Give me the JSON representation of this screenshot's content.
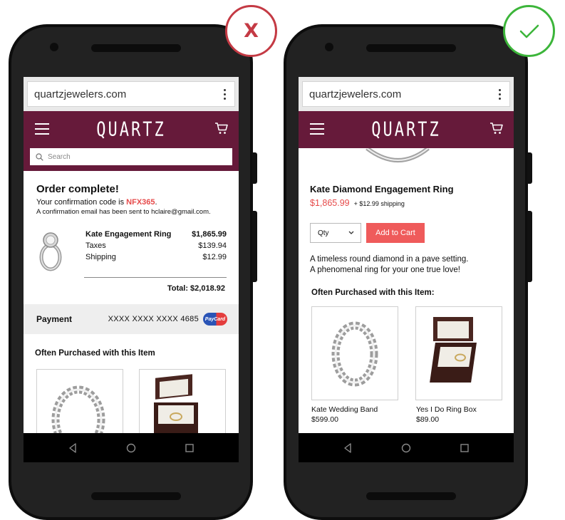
{
  "left_phone": {
    "url": "quartzjewelers.com",
    "brand": "QUARTZ",
    "search_placeholder": "Search",
    "order": {
      "title": "Order complete!",
      "confirm_prefix": "Your confirmation code is ",
      "code": "NFX365",
      "confirm_suffix": ".",
      "email_note": "A confirmation email has been sent to hclaire@gmail.com."
    },
    "line_items": [
      {
        "label": "Kate Engagement Ring",
        "value": "$1,865.99"
      },
      {
        "label": "Taxes",
        "value": "$139.94"
      },
      {
        "label": "Shipping",
        "value": "$12.99"
      }
    ],
    "total": "Total: $2,018.92",
    "payment": {
      "label": "Payment",
      "card_number": "XXXX XXXX XXXX 4685",
      "card_brand": "PayCard"
    },
    "often_title": "Often Purchased with this Item"
  },
  "right_phone": {
    "url": "quartzjewelers.com",
    "brand": "QUARTZ",
    "product": {
      "name": "Kate Diamond Engagement Ring",
      "price": "$1,865.99",
      "shipping": "+ $12.99 shipping"
    },
    "qty_label": "Qty",
    "add_to_cart": "Add to Cart",
    "description": [
      "A timeless round diamond in a pave setting.",
      "A phenomenal ring for your one true love!"
    ],
    "often_title": "Often Purchased with this Item:",
    "related": [
      {
        "name": "Kate Wedding Band",
        "price": "$599.00"
      },
      {
        "name": "Yes I Do Ring Box",
        "price": "$89.00"
      }
    ]
  },
  "badges": {
    "wrong_mark": "X",
    "wrong_color": "#c43a44",
    "right_color": "#3cb53a"
  },
  "colors": {
    "brand_bar": "#661a3a",
    "accent": "#ef5b5b",
    "code_color": "#e64a4a"
  }
}
